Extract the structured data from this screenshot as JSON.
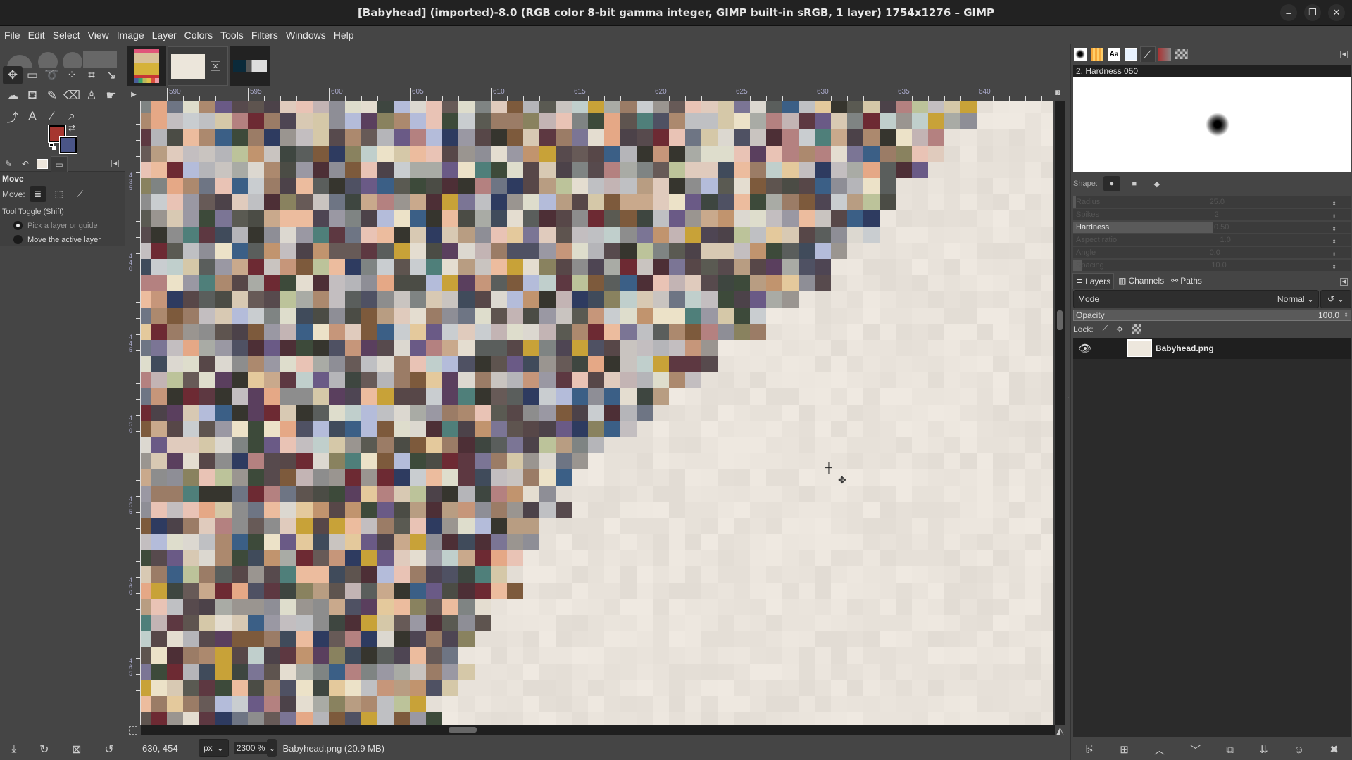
{
  "window": {
    "title": "[Babyhead] (imported)-8.0 (RGB color 8-bit gamma integer, GIMP built-in sRGB, 1 layer) 1754x1276 – GIMP",
    "minimize": "–",
    "restore": "❐",
    "close": "✕"
  },
  "menu": [
    "File",
    "Edit",
    "Select",
    "View",
    "Image",
    "Layer",
    "Colors",
    "Tools",
    "Filters",
    "Windows",
    "Help"
  ],
  "toolbox": {
    "tools": [
      {
        "name": "move-tool",
        "glyph": "✥",
        "active": true
      },
      {
        "name": "rect-select-tool",
        "glyph": "▭"
      },
      {
        "name": "free-select-tool",
        "glyph": "➰"
      },
      {
        "name": "fuzzy-select-tool",
        "glyph": "⁘"
      },
      {
        "name": "crop-tool",
        "glyph": "⌗"
      },
      {
        "name": "unified-transform-tool",
        "glyph": "↘"
      },
      {
        "name": "warp-transform-tool",
        "glyph": "☁"
      },
      {
        "name": "bucket-fill-tool",
        "glyph": "⛾"
      },
      {
        "name": "paintbrush-tool",
        "glyph": "✎"
      },
      {
        "name": "eraser-tool",
        "glyph": "⌫"
      },
      {
        "name": "clone-tool",
        "glyph": "♙"
      },
      {
        "name": "smudge-tool",
        "glyph": "☛"
      },
      {
        "name": "paths-tool",
        "glyph": "⤴"
      },
      {
        "name": "text-tool",
        "glyph": "A"
      },
      {
        "name": "color-picker-tool",
        "glyph": "⁄"
      },
      {
        "name": "zoom-tool",
        "glyph": "⌕"
      }
    ],
    "fg_color": "#a63630",
    "bg_color": "#4a5587",
    "dock_tabs": [
      "tool-options",
      "undo-history",
      "images",
      "device-status"
    ],
    "options": {
      "title": "Move",
      "move_label": "Move:",
      "toggle_label": "Tool Toggle  (Shift)",
      "radio": [
        {
          "label": "Pick a layer or guide",
          "checked": true
        },
        {
          "label": "Move the active layer",
          "checked": false
        }
      ]
    },
    "footer": [
      "save-options",
      "restore-options",
      "delete-options",
      "reset-options"
    ]
  },
  "image_tabs": [
    {
      "name": "teen-cover",
      "active": false
    },
    {
      "name": "babyhead",
      "active": true
    },
    {
      "name": "gimp-screenshot",
      "active": false
    }
  ],
  "rulers": {
    "h_labels": [
      "590",
      "595",
      "600",
      "605",
      "610",
      "615",
      "620",
      "625",
      "630",
      "635",
      "640"
    ],
    "v_labels": [
      "435",
      "440",
      "445",
      "450",
      "455",
      "460",
      "465"
    ]
  },
  "statusbar": {
    "coords": "630, 454",
    "unit": "px",
    "zoom": "2300 %",
    "file_info": "Babyhead.png (20.9 MB)"
  },
  "brushes": {
    "selected": "2. Hardness 050",
    "shape_label": "Shape:",
    "params": [
      {
        "label": "Radius",
        "value": "25.0",
        "fraction": 0.01
      },
      {
        "label": "Spikes",
        "value": "2",
        "fraction": 0
      },
      {
        "label": "Hardness",
        "value": "0.50",
        "fraction": 0.5
      },
      {
        "label": "Aspect ratio",
        "value": "1.0",
        "fraction": 0
      },
      {
        "label": "Angle",
        "value": "0.0",
        "fraction": 0
      },
      {
        "label": "Spacing",
        "value": "10.0",
        "fraction": 0.03
      }
    ]
  },
  "layers": {
    "tabs": [
      "Layers",
      "Channels",
      "Paths"
    ],
    "mode_label": "Mode",
    "mode_value": "Normal",
    "opacity_label": "Opacity",
    "opacity_value": "100.0",
    "lock_label": "Lock:",
    "items": [
      {
        "name": "Babyhead.png",
        "visible": true
      }
    ]
  }
}
